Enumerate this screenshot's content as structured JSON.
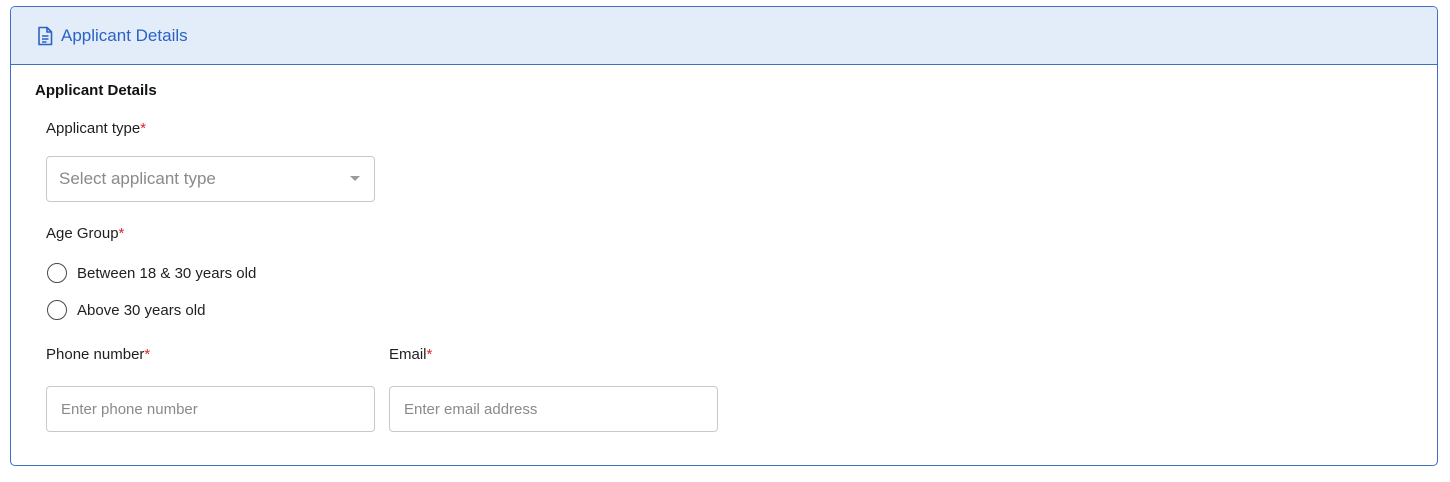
{
  "header": {
    "title": "Applicant Details",
    "icon": "document-icon",
    "accent_color": "#2b63c4",
    "background_color": "#e3ecf9"
  },
  "section": {
    "title": "Applicant Details"
  },
  "applicant_type": {
    "label": "Applicant type",
    "required_mark": "*",
    "placeholder": "Select applicant type"
  },
  "age_group": {
    "label": "Age Group",
    "required_mark": "*",
    "options": [
      {
        "label": "Between 18 & 30 years old",
        "selected": false
      },
      {
        "label": "Above 30 years old",
        "selected": false
      }
    ]
  },
  "phone": {
    "label": "Phone number",
    "required_mark": "*",
    "placeholder": "Enter phone number",
    "value": ""
  },
  "email": {
    "label": "Email",
    "required_mark": "*",
    "placeholder": "Enter email address",
    "value": ""
  }
}
